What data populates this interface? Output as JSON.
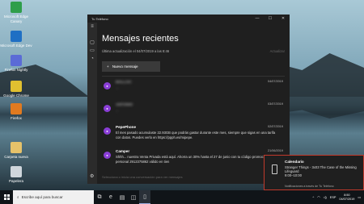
{
  "desktop": {
    "icons": [
      {
        "label": "Microsoft Edge Canary",
        "color": "#2e9e4a"
      },
      {
        "label": "Microsoft Edge Dev",
        "color": "#1f6fc4"
      },
      {
        "label": "Firefox Nightly",
        "color": "#5b6bd6"
      },
      {
        "label": "Google Chrome",
        "color": "#e0c030"
      },
      {
        "label": "Firefox",
        "color": "#e07a20"
      },
      {
        "label": "Carpeta nueva",
        "color": "#e6c26a"
      },
      {
        "label": "Papelera",
        "color": "#cfd6dc"
      }
    ]
  },
  "window": {
    "title": "Tu Teléfono",
    "heading": "Mensajes recientes",
    "updated": "Última actualización el 04/07/2019 a las 8:46",
    "refresh_label": "Actualizar",
    "new_message_label": "Nuevo mensaje",
    "compose_placeholder": "Selecciona o inicia una conversación para ver mensajes",
    "conversations": [
      {
        "name": "MALLOC",
        "date": "04/07/2019",
        "preview": "...",
        "blurred": true
      },
      {
        "name": "ANTONIO",
        "date": "03/07/2019",
        "preview": "...",
        "blurred": true
      },
      {
        "name": "PepePhone",
        "date": "02/07/2019",
        "preview": "El mes pasado acumulaste 22.93GB que podrás gastar durante este mes, siempre que sigas en una tarifa con datos. Puedes verlo en https://ppph.es/mipepe.",
        "blurred": false
      },
      {
        "name": "Camper",
        "date": "21/06/2019",
        "preview": "Shhh... nuestra Venta Privada está aquí. Ahorra un 30% hasta el 27 de junio con tu código promocional personal 2912375862 válido en tien",
        "blurred": false
      }
    ]
  },
  "toast": {
    "title": "Calendario",
    "line1": "Stranger Things - 3x03 The Case of the Missing Lifeguard",
    "line2": "9:00–10:00",
    "footer": "Notificaciones a través de Tu Teléfono"
  },
  "taskbar": {
    "search_placeholder": "Escribe aquí para buscar",
    "lang": "ESP",
    "time": "8:50",
    "date": "04/07/2019"
  }
}
